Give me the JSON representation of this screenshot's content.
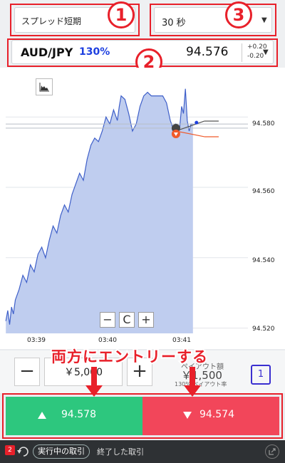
{
  "header": {
    "strategy": "スプレッド短期",
    "period": "30 秒",
    "pair": "AUD/JPY",
    "payout_pct": "130%",
    "price": "94.576",
    "change_up": "+0.20",
    "change_down": "-0.20"
  },
  "annotations": {
    "num1": "1",
    "num2": "2",
    "num3": "3",
    "overlay": "両方にエントリーする"
  },
  "chart_data": {
    "type": "area",
    "x_ticks": [
      "03:39",
      "03:40",
      "03:41"
    ],
    "y_ticks": [
      "94.580",
      "94.560",
      "94.540",
      "94.520"
    ],
    "ylim": [
      94.5185,
      94.593
    ],
    "x": [
      0,
      0.01,
      0.02,
      0.03,
      0.04,
      0.05,
      0.07,
      0.09,
      0.11,
      0.13,
      0.15,
      0.17,
      0.19,
      0.21,
      0.23,
      0.25,
      0.27,
      0.29,
      0.31,
      0.33,
      0.35,
      0.37,
      0.39,
      0.41,
      0.43,
      0.45,
      0.47,
      0.49,
      0.51,
      0.53,
      0.55,
      0.57,
      0.59,
      0.6,
      0.61,
      0.63,
      0.65,
      0.67,
      0.69,
      0.71,
      0.73,
      0.75,
      0.77,
      0.79,
      0.81,
      0.83,
      0.85,
      0.87,
      0.89,
      0.9,
      0.91,
      0.92,
      0.93,
      0.94,
      0.95,
      0.96,
      0.97,
      0.98,
      0.99
    ],
    "values": [
      94.522,
      94.525,
      94.521,
      94.526,
      94.524,
      94.528,
      94.531,
      94.535,
      94.533,
      94.538,
      94.536,
      94.541,
      94.543,
      94.54,
      94.545,
      94.549,
      94.547,
      94.552,
      94.555,
      94.553,
      94.558,
      94.561,
      94.564,
      94.562,
      94.568,
      94.572,
      94.574,
      94.573,
      94.576,
      94.58,
      94.578,
      94.582,
      94.579,
      94.583,
      94.586,
      94.585,
      94.581,
      94.576,
      94.578,
      94.583,
      94.586,
      94.587,
      94.586,
      94.586,
      94.586,
      94.586,
      94.584,
      94.579,
      94.576,
      94.578,
      94.577,
      94.577,
      94.583,
      94.581,
      94.588,
      94.579,
      94.576,
      94.578,
      94.578
    ],
    "entry_price": 94.576,
    "upper_line": 94.578,
    "lower_line": 94.574
  },
  "chart_controls": {
    "zoom_out": "−",
    "reset": "C",
    "zoom_in": "+"
  },
  "order": {
    "minus": "−",
    "amount": "￥5,000",
    "plus": "+",
    "payout_label": "ペイアウト額",
    "payout_amount": "￥1,500",
    "payout_rate": "130% ペイアウト率",
    "count": "1"
  },
  "trade": {
    "buy_price": "94.578",
    "sell_price": "94.574"
  },
  "footer": {
    "count": "2",
    "active_tab": "実行中の取引",
    "closed_tab": "終了した取引"
  },
  "colors": {
    "accent_red": "#e8202a",
    "buy_green": "#2dc77e",
    "sell_red": "#f2465a",
    "area_fill": "#bfcdef",
    "area_line": "#3e5fc9"
  }
}
